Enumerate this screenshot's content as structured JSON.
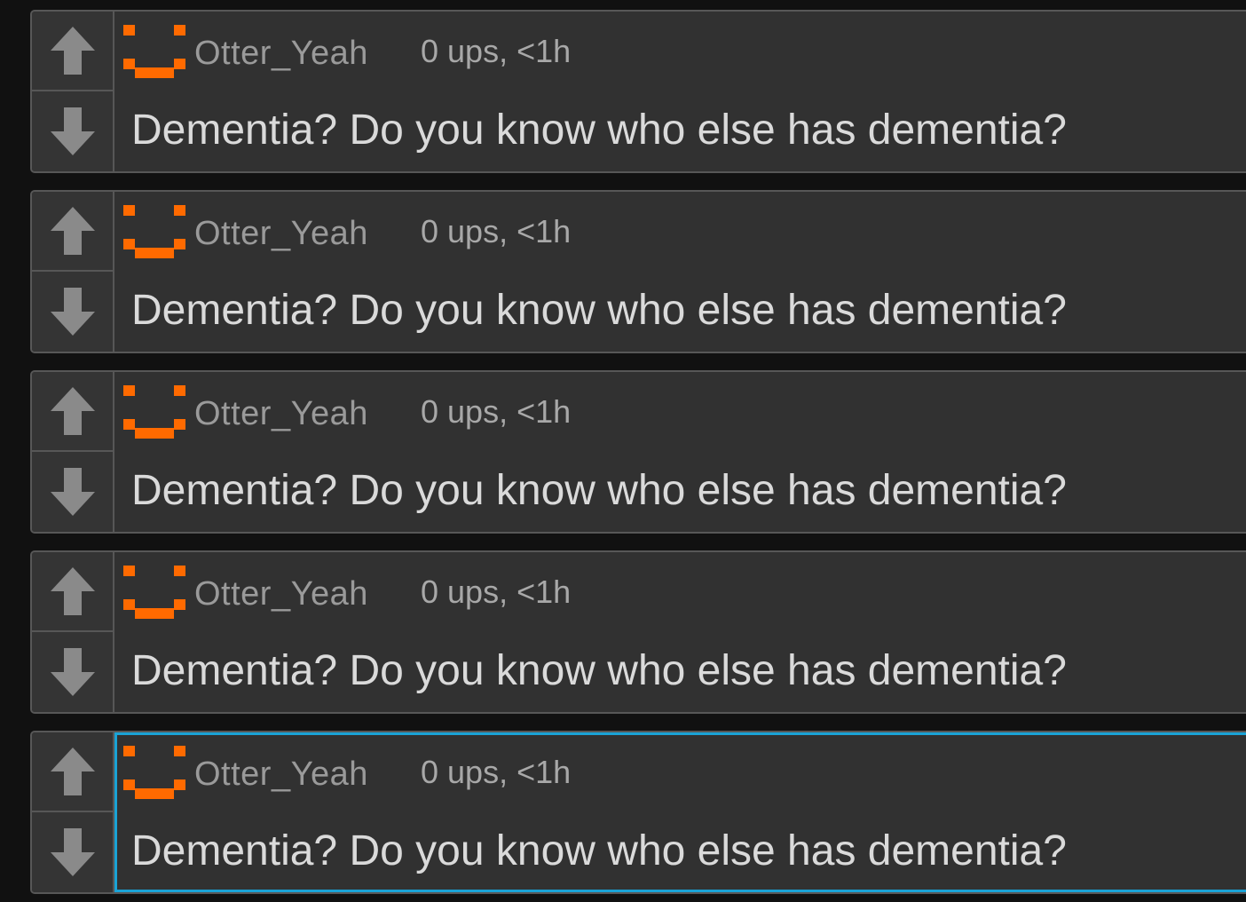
{
  "comments": [
    {
      "username": "Otter_Yeah",
      "meta": "0 ups, <1h",
      "text": "Dementia? Do you know who else has dementia?",
      "selected": false
    },
    {
      "username": "Otter_Yeah",
      "meta": "0 ups, <1h",
      "text": "Dementia? Do you know who else has dementia?",
      "selected": false
    },
    {
      "username": "Otter_Yeah",
      "meta": "0 ups, <1h",
      "text": "Dementia? Do you know who else has dementia?",
      "selected": false
    },
    {
      "username": "Otter_Yeah",
      "meta": "0 ups, <1h",
      "text": "Dementia? Do you know who else has dementia?",
      "selected": false
    },
    {
      "username": "Otter_Yeah",
      "meta": "0 ups, <1h",
      "text": "Dementia? Do you know who else has dementia?",
      "selected": true
    }
  ],
  "icons": {
    "upvote": "arrow-up-icon",
    "downvote": "arrow-down-icon",
    "avatar": "pixel-smiley-avatar"
  },
  "colors": {
    "background": "#111111",
    "card": "#313131",
    "border": "#575757",
    "avatar_accent": "#ff6a00",
    "selection": "#1aa3d6",
    "arrow": "#8a8a8a"
  }
}
